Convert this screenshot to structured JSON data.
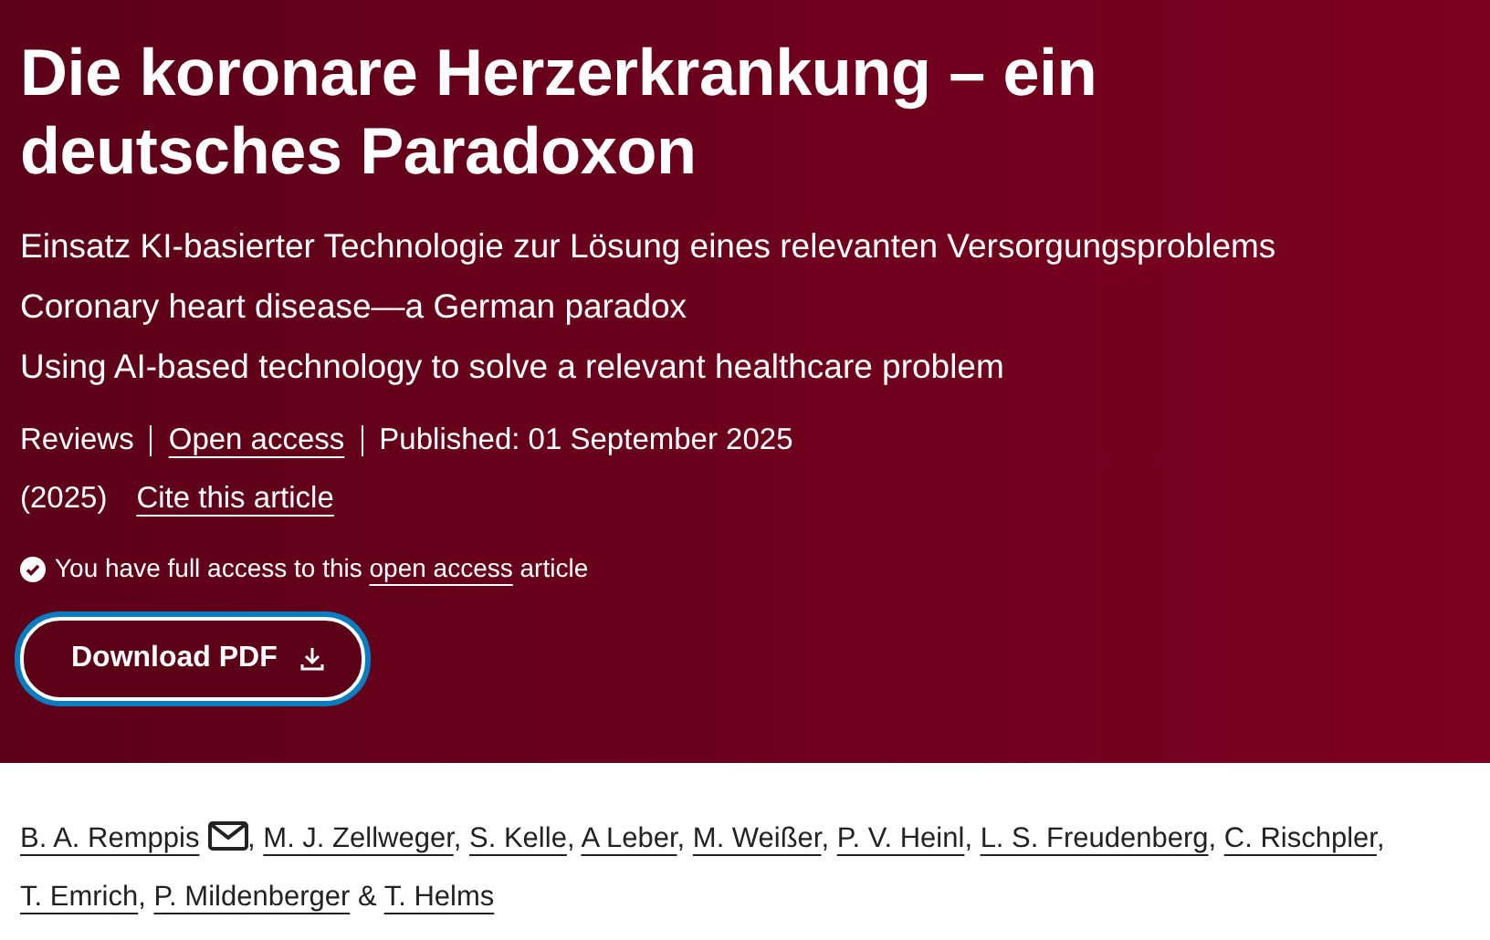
{
  "header": {
    "title": "Die koronare Herzerkrankung – ein deutsches Paradoxon",
    "subtitles": [
      "Einsatz KI-basierter Technologie zur Lösung eines relevanten Versorgungsproblems",
      "Coronary heart disease—a German paradox",
      "Using AI-based technology to solve a relevant healthcare problem"
    ],
    "meta": [
      {
        "kind": "text",
        "text": "Reviews"
      },
      {
        "kind": "link",
        "text": "Open access"
      },
      {
        "kind": "text",
        "text": "Published: 01 September 2025"
      }
    ],
    "meta2": [
      {
        "kind": "text",
        "text": "(2025)"
      },
      {
        "kind": "link",
        "text": "Cite this article"
      }
    ],
    "access": {
      "before": "You have full access to this",
      "link": "open access",
      "after": "article"
    },
    "download": {
      "label": "Download PDF",
      "focused": true
    }
  },
  "authors": [
    {
      "name": "B. A. Remppis",
      "email": true,
      "sep": ","
    },
    {
      "name": "M. J. Zellweger",
      "email": false,
      "sep": ","
    },
    {
      "name": "S. Kelle",
      "email": false,
      "sep": ","
    },
    {
      "name": "A Leber",
      "email": false,
      "sep": ","
    },
    {
      "name": "M. Weißer",
      "email": false,
      "sep": ","
    },
    {
      "name": "P. V. Heinl",
      "email": false,
      "sep": ","
    },
    {
      "name": "L. S. Freudenberg",
      "email": false,
      "sep": ","
    },
    {
      "name": "C. Rischpler",
      "email": false,
      "sep": ","
    },
    {
      "name": "T. Emrich",
      "email": false,
      "sep": ","
    },
    {
      "name": "P. Mildenberger",
      "email": false,
      "sep": "&"
    },
    {
      "name": "T. Helms",
      "email": false
    }
  ]
}
